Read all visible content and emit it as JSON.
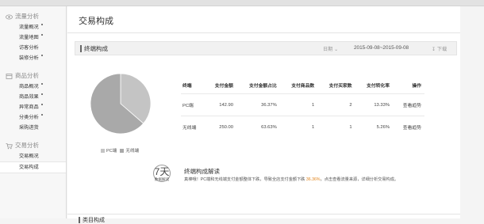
{
  "sidebar": {
    "sections": [
      {
        "label": "流量分析",
        "icon": "eye-icon",
        "items": [
          {
            "label": "流量概况",
            "dot": true
          },
          {
            "label": "流量地图",
            "dot": true
          },
          {
            "label": "访客分析",
            "dot": false
          },
          {
            "label": "装修分析",
            "dot": true
          }
        ]
      },
      {
        "label": "商品分析",
        "icon": "package-icon",
        "items": [
          {
            "label": "商品概况",
            "dot": true
          },
          {
            "label": "商品效果",
            "dot": true
          },
          {
            "label": "异常商品",
            "dot": true
          },
          {
            "label": "分类分析",
            "dot": true
          },
          {
            "label": "采购进货",
            "dot": false
          }
        ]
      },
      {
        "label": "交易分析",
        "icon": "cart-icon",
        "items": [
          {
            "label": "交易概况",
            "dot": false
          },
          {
            "label": "交易构成",
            "dot": false,
            "active": true
          }
        ]
      }
    ]
  },
  "page": {
    "title": "交易构成"
  },
  "panel": {
    "title": "终端构成",
    "date_label": "日期",
    "date_range": "2015-09-08~2015-09-08",
    "download_label": "下载"
  },
  "chart_data": {
    "type": "pie",
    "series": [
      {
        "name": "PC端",
        "value": 36.37
      },
      {
        "name": "无线端",
        "value": 63.63
      }
    ],
    "colors": [
      "#c4c4c4",
      "#a9a9a9"
    ]
  },
  "legend": {
    "pc": "PC端",
    "wireless": "无线端"
  },
  "table": {
    "headers": [
      "终端",
      "支付金额",
      "支付金额占比",
      "支付商品数",
      "支付买家数",
      "支付转化率",
      "操作"
    ],
    "rows": [
      [
        "PC端",
        "142.90",
        "36.37%",
        "1",
        "2",
        "13.33%",
        "查看趋势"
      ],
      [
        "无线端",
        "250.00",
        "63.63%",
        "1",
        "1",
        "5.26%",
        "查看趋势"
      ]
    ]
  },
  "interpretation": {
    "badge_num": "7天",
    "badge_label": "数据解读",
    "title": "终端构成解读",
    "text_before": "真棒哦！PC端和无线端支付金额整体下跌，导致全店支付金额下跌",
    "highlight": "36.36%",
    "text_after": "，点击查看流量来源，详细分析交易构成。"
  },
  "next_section": {
    "title": "类目构成"
  }
}
